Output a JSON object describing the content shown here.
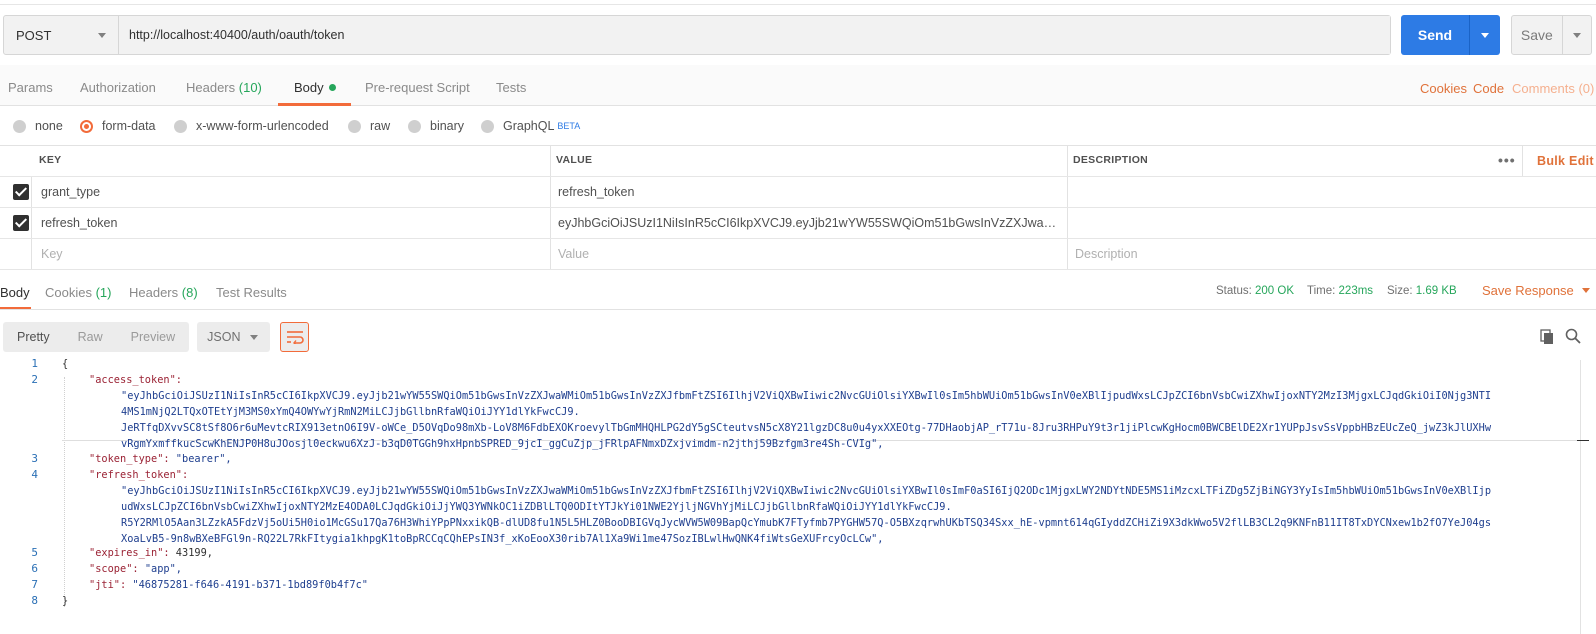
{
  "request": {
    "method": "POST",
    "url": "http://localhost:40400/auth/oauth/token",
    "send_label": "Send",
    "save_label": "Save"
  },
  "request_tabs": {
    "params": "Params",
    "authorization": "Authorization",
    "headers": "Headers",
    "headers_count": "(10)",
    "body": "Body",
    "prerequest": "Pre-request Script",
    "tests": "Tests",
    "cookies": "Cookies",
    "code": "Code",
    "comments": "Comments (0)"
  },
  "body_types": {
    "none": "none",
    "form_data": "form-data",
    "urlencoded": "x-www-form-urlencoded",
    "raw": "raw",
    "binary": "binary",
    "graphql": "GraphQL",
    "beta": "BETA"
  },
  "params_table": {
    "headers": {
      "key": "KEY",
      "value": "VALUE",
      "description": "DESCRIPTION"
    },
    "bulk_edit": "Bulk Edit",
    "rows": [
      {
        "key": "grant_type",
        "value": "refresh_token",
        "checked": true
      },
      {
        "key": "refresh_token",
        "value": "eyJhbGciOiJSUzI1NiIsInR5cCI6IkpXVCJ9.eyJjb21wYW55SWQiOm51bGwsInVzZXJwaWMiO...",
        "checked": true
      }
    ],
    "placeholder": {
      "key": "Key",
      "value": "Value",
      "description": "Description"
    }
  },
  "response_tabs": {
    "body": "Body",
    "cookies": "Cookies",
    "cookies_count": "(1)",
    "headers": "Headers",
    "headers_count": "(8)",
    "test_results": "Test Results"
  },
  "response_status": {
    "status_label": "Status:",
    "status_value": "200 OK",
    "time_label": "Time:",
    "time_value": "223ms",
    "size_label": "Size:",
    "size_value": "1.69 KB",
    "save_response": "Save Response"
  },
  "response_toolbar": {
    "pretty": "Pretty",
    "raw": "Raw",
    "preview": "Preview",
    "format": "JSON"
  },
  "code": {
    "line_numbers": [
      "1",
      "2",
      "3",
      "4",
      "5",
      "6",
      "7",
      "8"
    ],
    "l1": "{",
    "l2_key": "\"access_token\":",
    "l2_a": "\"eyJhbGciOiJSUzI1NiIsInR5cCI6IkpXVCJ9.eyJjb21wYW55SWQiOm51bGwsInVzZXJwaWMiOm51bGwsInVzZXJfbmFtZSI6IlhjV2ViQXBwIiwic2NvcGUiOlsiYXBwIl0sIm5hbWUiOm51bGwsInV0eXBlIjpudWxsLCJpZCI6bnVsbCwiZXhwIjoxNTY2MzI3MjgxLCJqdGkiOiI0Njg3NTI",
    "l2_b": "4MS1mNjQ2LTQxOTEtYjM3MS0xYmQ4OWYwYjRmN2MiLCJjbGllbnRfaWQiOiJYY1dlYkFwcCJ9.",
    "l2_c": "JeRTfqDXvvSC8tSf8O6r6uMevtcRIX913etnO6I9V-oWCe_D5OVqDo98mXb-LoV8M6FdbEXOKroevylTbGmMHQHLPG2dY5gSCteutvsN5cX8Y21lgzDC8u0u4yxXXEOtg-77DHaobjAP_rT71u-8Jru3RHPuY9t3r1jiPlcwKgHocm0BWCBElDE2Xr1YUPpJsvSsVppbHBzEUcZeQ_jwZ3kJlUXHw",
    "l2_d": "vRgmYxmffkucScwKhENJP0H8uJOosjl0eckwu6XzJ-b3qD0TGGh9hxHpnbSPRED_9jcI_ggCuZjp_jFRlpAFNmxDZxjvimdm-n2jthj59Bzfgm3re4Sh-CVIg\",",
    "l3_key": "\"token_type\":",
    "l3_val": "\"bearer\",",
    "l4_key": "\"refresh_token\":",
    "l4_a": "\"eyJhbGciOiJSUzI1NiIsInR5cCI6IkpXVCJ9.eyJjb21wYW55SWQiOm51bGwsInVzZXJwaWMiOm51bGwsInVzZXJfbmFtZSI6IlhjV2ViQXBwIiwic2NvcGUiOlsiYXBwIl0sImF0aSI6IjQ2ODc1MjgxLWY2NDYtNDE5MS1iMzcxLTFiZDg5ZjBiNGY3YyIsIm5hbWUiOm51bGwsInV0eXBlIjp",
    "l4_b": "udWxsLCJpZCI6bnVsbCwiZXhwIjoxNTY2MzE4ODA0LCJqdGkiOiJjYWQ3YWNkOC1iZDBlLTQ0ODItYTJkYi01NWE2YjljNGVhYjMiLCJjbGllbnRfaWQiOiJYY1dlYkFwcCJ9.",
    "l4_c": "R5Y2RMlO5Aan3LZzkA5FdzVj5oUi5H0io1McGSu17Qa76H3WhiYPpPNxxikQB-dlUD8fu1N5L5HLZ0BooDBIGVqJycWVW5W09BapQcYmubK7FTyfmb7PYGHW57Q-O5BXzqrwhUKbTSQ34Sxx_hE-vpmnt614qGIyddZCHiZi9X3dkWwo5V2flLB3CL2q9KNFnB11IT8TxDYCNxew1b2fO7YeJ04gs",
    "l4_d": "XoaLvB5-9n8wBXeBFGl9n-RQ22L7RkFItygia1khpgK1toBpRCCqCQhEPsIN3f_xKoEooX30rib7Al1Xa9Wi1me47SozIBLwlHwQNK4fiWtsGeXUFrcyOcLCw\",",
    "l5_key": "\"expires_in\":",
    "l5_val": "43199,",
    "l6_key": "\"scope\":",
    "l6_val": "\"app\",",
    "l7_key": "\"jti\":",
    "l7_val": "\"46875281-f646-4191-b371-1bd89f0b4f7c\"",
    "l8": "}"
  }
}
